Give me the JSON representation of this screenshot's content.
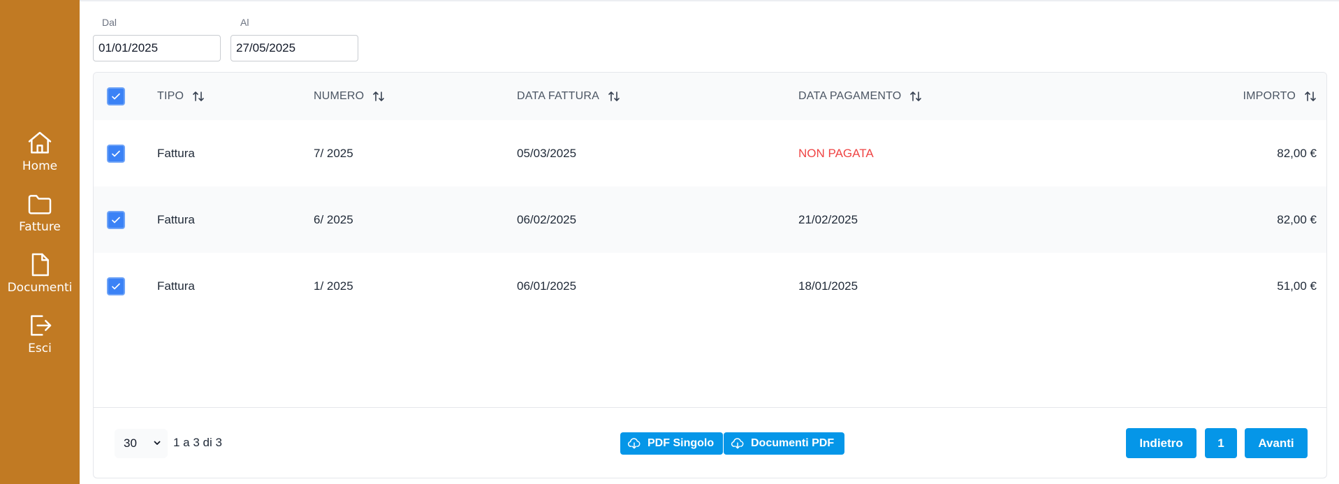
{
  "sidebar": {
    "items": [
      {
        "label": "Home",
        "icon": "home-icon"
      },
      {
        "label": "Fatture",
        "icon": "folder-icon"
      },
      {
        "label": "Documenti",
        "icon": "document-icon"
      },
      {
        "label": "Esci",
        "icon": "logout-icon"
      }
    ]
  },
  "filters": {
    "from_label": "Dal",
    "from_value": "01/01/2025",
    "to_label": "Al",
    "to_value": "27/05/2025"
  },
  "table": {
    "columns": [
      "TIPO",
      "NUMERO",
      "DATA FATTURA",
      "DATA PAGAMENTO",
      "IMPORTO"
    ],
    "rows": [
      {
        "checked": true,
        "tipo": "Fattura",
        "numero": "7/ 2025",
        "data_fattura": "05/03/2025",
        "data_pagamento": "NON PAGATA",
        "importo": "82,00 €"
      },
      {
        "checked": true,
        "tipo": "Fattura",
        "numero": "6/ 2025",
        "data_fattura": "06/02/2025",
        "data_pagamento": "21/02/2025",
        "importo": "82,00 €"
      },
      {
        "checked": true,
        "tipo": "Fattura",
        "numero": "1/ 2025",
        "data_fattura": "06/01/2025",
        "data_pagamento": "18/01/2025",
        "importo": "51,00 €"
      }
    ]
  },
  "footer": {
    "page_size": "30",
    "range_text": "1 a 3 di 3",
    "pdf_single_label": "PDF Singolo",
    "pdf_docs_label": "Documenti PDF",
    "prev_label": "Indietro",
    "current_page": "1",
    "next_label": "Avanti"
  },
  "colors": {
    "sidebar": "#c17a23",
    "primary": "#0596e8",
    "checkbox": "#3b82f6",
    "unpaid": "#ef4444"
  }
}
